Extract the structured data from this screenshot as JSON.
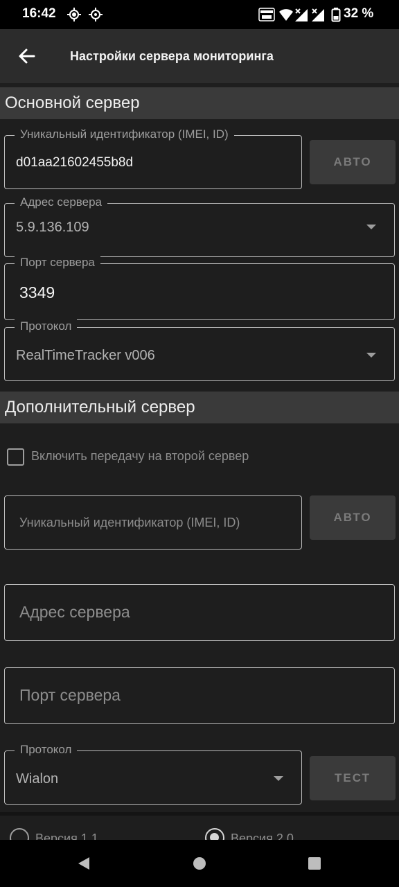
{
  "status_bar": {
    "time": "16:42",
    "battery": "32 %"
  },
  "app_bar": {
    "title": "Настройки сервера мониторинга"
  },
  "primary": {
    "header": "Основной сервер",
    "imei_label": "Уникальный идентификатор (IMEI, ID)",
    "imei_value": "d01aa21602455b8d",
    "auto_button": "АВТО",
    "address_label": "Адрес сервера",
    "address_value": "5.9.136.109",
    "port_label": "Порт сервера",
    "port_value": "3349",
    "protocol_label": "Протокол",
    "protocol_value": "RealTimeTracker v006"
  },
  "secondary": {
    "header": "Дополнительный сервер",
    "enable_label": "Включить передачу на второй сервер",
    "imei_placeholder": "Уникальный идентификатор (IMEI, ID)",
    "auto_button": "АВТО",
    "address_placeholder": "Адрес сервера",
    "port_placeholder": "Порт сервера",
    "protocol_label": "Протокол",
    "protocol_value": "Wialon",
    "test_button": "ТЕСТ",
    "version_1": "Версия 1.1",
    "version_2": "Версия 2.0"
  }
}
